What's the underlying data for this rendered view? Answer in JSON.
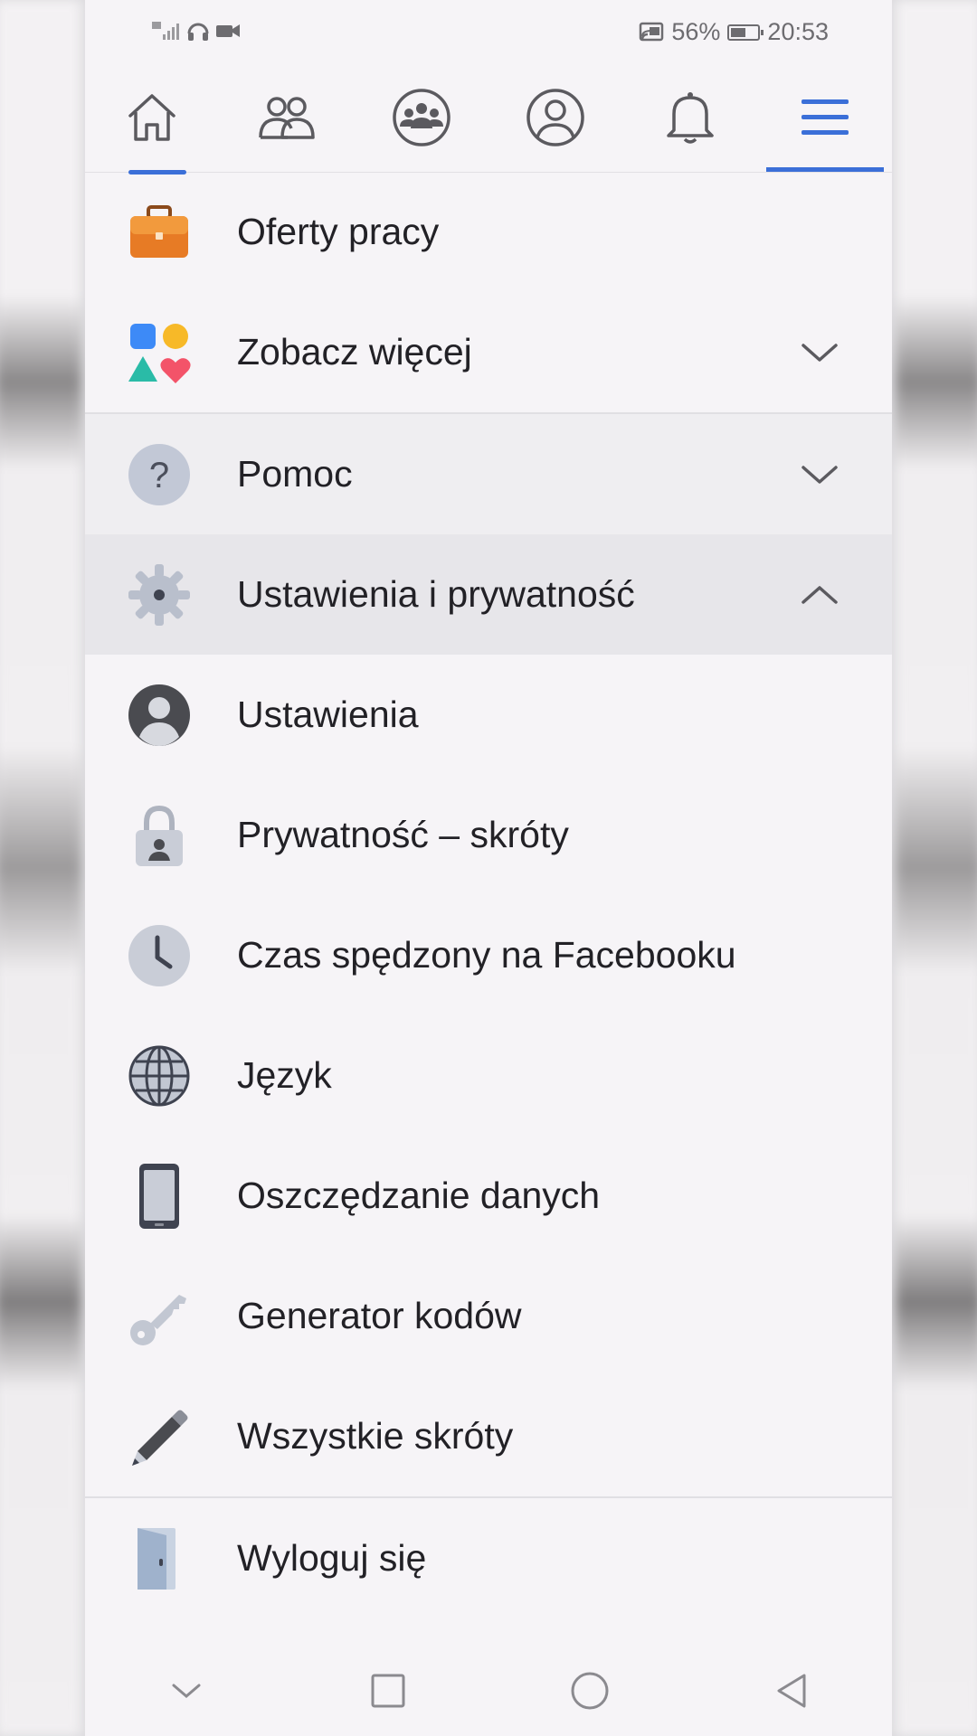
{
  "status_bar": {
    "battery_percent": "56%",
    "battery_level": 0.56,
    "time": "20:53"
  },
  "top_nav": {
    "tabs": [
      {
        "icon": "home-icon"
      },
      {
        "icon": "friends-icon"
      },
      {
        "icon": "groups-icon"
      },
      {
        "icon": "profile-icon"
      },
      {
        "icon": "bell-icon"
      },
      {
        "icon": "menu-icon",
        "active": true
      }
    ]
  },
  "menu": {
    "jobs": {
      "label": "Oferty pracy",
      "icon": "briefcase-icon"
    },
    "see_more": {
      "label": "Zobacz więcej",
      "icon": "shapes-icon"
    },
    "help": {
      "label": "Pomoc",
      "icon": "question-icon"
    },
    "settings_privacy": {
      "label": "Ustawienia i prywatność",
      "icon": "gear-icon",
      "expanded": true
    },
    "settings": {
      "label": "Ustawienia",
      "icon": "user-circle-icon"
    },
    "privacy_shortcuts": {
      "label": "Prywatność – skróty",
      "icon": "lock-icon"
    },
    "time_on_facebook": {
      "label": "Czas spędzony na Facebooku",
      "icon": "clock-icon"
    },
    "language": {
      "label": "Język",
      "icon": "globe-icon"
    },
    "data_saver": {
      "label": "Oszczędzanie danych",
      "icon": "phone-icon"
    },
    "code_generator": {
      "label": "Generator kodów",
      "icon": "key-icon"
    },
    "all_shortcuts": {
      "label": "Wszystkie skróty",
      "icon": "pencil-icon"
    },
    "logout": {
      "label": "Wyloguj się",
      "icon": "door-icon"
    }
  },
  "colors": {
    "accent": "#3b6fd8",
    "background": "#f6f4f7",
    "text": "#222126"
  }
}
